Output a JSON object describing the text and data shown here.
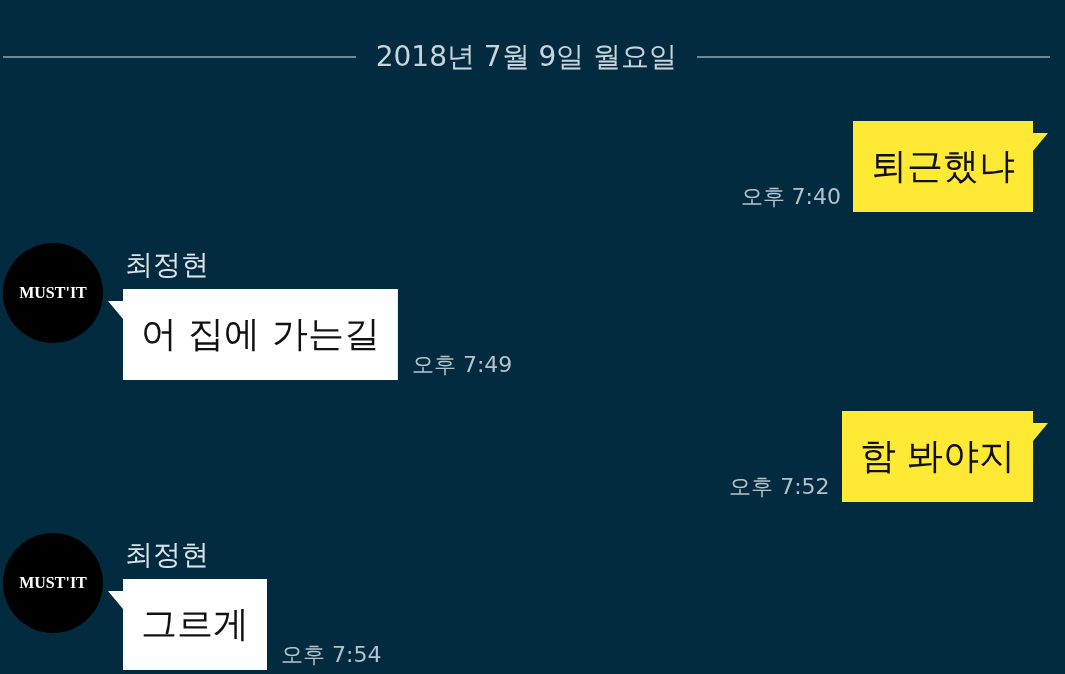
{
  "date_divider": "2018년 7월 9일 월요일",
  "messages": [
    {
      "kind": "sent",
      "text": "퇴근했냐",
      "time": "오후 7:40"
    },
    {
      "kind": "received",
      "sender": "최정현",
      "avatar_text": "MUST'IT",
      "text": "어 집에 가는길",
      "time": "오후 7:49"
    },
    {
      "kind": "sent",
      "text": "함 봐야지",
      "time": "오후 7:52"
    },
    {
      "kind": "received",
      "sender": "최정현",
      "avatar_text": "MUST'IT",
      "text": "그르게",
      "time": "오후 7:54"
    }
  ]
}
